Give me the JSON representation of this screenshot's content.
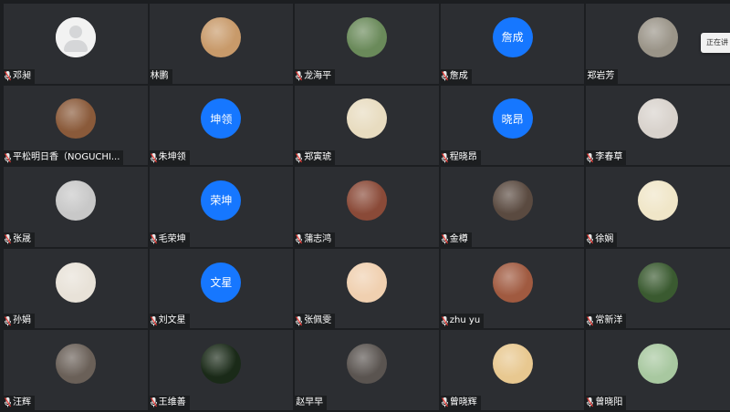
{
  "tooltip": {
    "text": "正在讲"
  },
  "participants": [
    {
      "name": "邓昶",
      "avatar": "default-person",
      "avatar_color": "#f2f2f2",
      "mic": true
    },
    {
      "name": "林鹏",
      "avatar": "photo",
      "avatar_color": "#c89a6a",
      "mic": false
    },
    {
      "name": "龙海平",
      "avatar": "photo",
      "avatar_color": "#6a8a5a",
      "mic": true
    },
    {
      "name": "詹成",
      "avatar_text": "詹成",
      "avatar": "text",
      "avatar_color": "#1677ff",
      "mic": true
    },
    {
      "name": "郑岩芳",
      "avatar": "photo",
      "avatar_color": "#9a9488",
      "mic": false
    },
    {
      "name": "平松明日香（NOGUCHI...",
      "avatar": "photo",
      "avatar_color": "#8a5a3a",
      "mic": true
    },
    {
      "name": "朱坤领",
      "avatar_text": "坤领",
      "avatar": "text",
      "avatar_color": "#1677ff",
      "mic": true
    },
    {
      "name": "郑寅琥",
      "avatar": "photo",
      "avatar_color": "#e8dcc0",
      "mic": true
    },
    {
      "name": "程晓昂",
      "avatar_text": "晓昂",
      "avatar": "text",
      "avatar_color": "#1677ff",
      "mic": true
    },
    {
      "name": "李春草",
      "avatar": "photo",
      "avatar_color": "#d8d2cc",
      "mic": true
    },
    {
      "name": "张晟",
      "avatar": "photo",
      "avatar_color": "#c8c8c8",
      "mic": true
    },
    {
      "name": "毛荣坤",
      "avatar_text": "荣坤",
      "avatar": "text",
      "avatar_color": "#1677ff",
      "mic": true
    },
    {
      "name": "蒲志鸿",
      "avatar": "photo",
      "avatar_color": "#8a4a38",
      "mic": true
    },
    {
      "name": "金樽",
      "avatar": "photo",
      "avatar_color": "#5a4a40",
      "mic": true
    },
    {
      "name": "徐娴",
      "avatar": "photo",
      "avatar_color": "#f0e6c8",
      "mic": true
    },
    {
      "name": "孙娟",
      "avatar": "photo",
      "avatar_color": "#e8e2d8",
      "mic": true
    },
    {
      "name": "刘文星",
      "avatar_text": "文星",
      "avatar": "text",
      "avatar_color": "#1677ff",
      "mic": true
    },
    {
      "name": "张佩雯",
      "avatar": "photo",
      "avatar_color": "#f0d0b0",
      "mic": true
    },
    {
      "name": "zhu yu",
      "avatar": "photo",
      "avatar_color": "#a05a40",
      "mic": true
    },
    {
      "name": "常新洋",
      "avatar": "photo",
      "avatar_color": "#3a5a30",
      "mic": true
    },
    {
      "name": "汪辉",
      "avatar": "photo",
      "avatar_color": "#6a6058",
      "mic": true
    },
    {
      "name": "王维善",
      "avatar": "photo",
      "avatar_color": "#1a2a18",
      "mic": true
    },
    {
      "name": "赵早早",
      "avatar": "photo",
      "avatar_color": "#5a5450",
      "mic": false
    },
    {
      "name": "曾晓辉",
      "avatar": "photo",
      "avatar_color": "#e8c890",
      "mic": true
    },
    {
      "name": "曾晓阳",
      "avatar": "photo",
      "avatar_color": "#a8c8a0",
      "mic": true
    }
  ]
}
